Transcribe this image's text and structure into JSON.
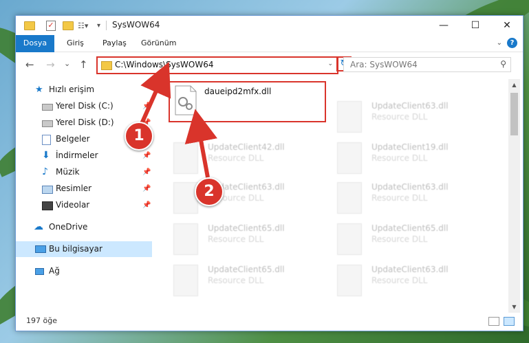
{
  "window": {
    "title": "SysWOW64",
    "controls": {
      "minimize": "—",
      "maximize": "☐",
      "close": "✕"
    }
  },
  "ribbon": {
    "tabs": [
      "Dosya",
      "Giriş",
      "Paylaş",
      "Görünüm"
    ],
    "help_label": "?"
  },
  "navigation": {
    "back": "←",
    "forward": "→",
    "recent": "⌄",
    "up": "↑",
    "address": "C:\\Windows\\SysWOW64",
    "refresh": "↻",
    "search_placeholder": "Ara: SysWOW64"
  },
  "sidebar": {
    "items": [
      {
        "label": "Hızlı erişim",
        "icon": "star-icon",
        "pinned": false
      },
      {
        "label": "Yerel Disk (C:)",
        "icon": "drive-icon",
        "pinned": true
      },
      {
        "label": "Yerel Disk (D:)",
        "icon": "drive-icon",
        "pinned": true
      },
      {
        "label": "Belgeler",
        "icon": "documents-icon",
        "pinned": true
      },
      {
        "label": "İndirmeler",
        "icon": "download-icon",
        "pinned": true
      },
      {
        "label": "Müzik",
        "icon": "music-icon",
        "pinned": true
      },
      {
        "label": "Resimler",
        "icon": "pictures-icon",
        "pinned": true
      },
      {
        "label": "Videolar",
        "icon": "video-icon",
        "pinned": true
      },
      {
        "label": "OneDrive",
        "icon": "cloud-icon",
        "pinned": false
      },
      {
        "label": "Bu bilgisayar",
        "icon": "computer-icon",
        "pinned": false,
        "selected": true
      },
      {
        "label": "Ağ",
        "icon": "network-icon",
        "pinned": false
      }
    ],
    "pin_glyph": "📌"
  },
  "files": [
    {
      "name": "daueipd2mfx.dll",
      "type": "",
      "highlighted": true
    },
    {
      "name": "UpdateClient63.dll",
      "type": "Resource DLL"
    },
    {
      "name": "UpdateClient42.dll",
      "type": "Resource DLL"
    },
    {
      "name": "UpdateClient19.dll",
      "type": "Resource DLL"
    },
    {
      "name": "UpdateClient63.dll",
      "type": "Resource DLL"
    },
    {
      "name": "UpdateClient63.dll",
      "type": "Resource DLL"
    },
    {
      "name": "UpdateClient65.dll",
      "type": "Resource DLL"
    },
    {
      "name": "UpdateClient65.dll",
      "type": "Resource DLL"
    },
    {
      "name": "UpdateClient65.dll",
      "type": "Resource DLL"
    },
    {
      "name": "UpdateClient63.dll",
      "type": "Resource DLL"
    }
  ],
  "status": {
    "item_count": "197 öğe"
  },
  "annotations": {
    "step1": "1",
    "step2": "2"
  },
  "colors": {
    "accent": "#1979ca",
    "highlight": "#d9342b",
    "selected": "#cce8ff"
  }
}
